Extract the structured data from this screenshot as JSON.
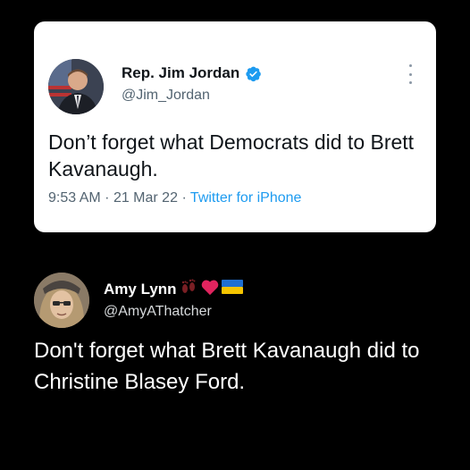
{
  "quoted_tweet": {
    "name": "Rep. Jim Jordan",
    "handle": "@Jim_Jordan",
    "text": "Don’t forget what Democrats did to Brett Kavanaugh.",
    "time": "9:53 AM",
    "separator": "·",
    "date": "21 Mar 22",
    "source": "Twitter for iPhone",
    "verified": true,
    "verified_color": "#1d9bf0"
  },
  "reply": {
    "name": "Amy Lynn",
    "name_emojis": [
      "footprints-icon",
      "heart-icon",
      "ukraine-flag-icon"
    ],
    "handle": "@AmyAThatcher",
    "text": "Don't forget what Brett Kavanaugh did to Christine Blasey Ford."
  },
  "colors": {
    "background": "#000000",
    "card": "#ffffff",
    "link": "#1d9bf0",
    "heart": "#e0245e"
  }
}
